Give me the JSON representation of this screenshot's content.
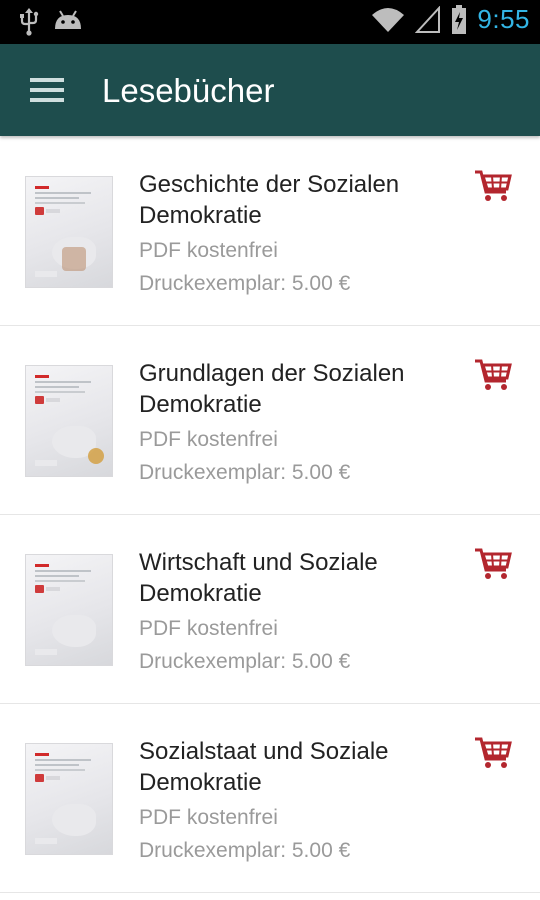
{
  "status_bar": {
    "time": "9:55",
    "icons": [
      "usb-icon",
      "android-icon",
      "wifi-icon",
      "signal-icon",
      "battery-charging-icon"
    ],
    "accent_color": "#33b5e5"
  },
  "action_bar": {
    "title": "Lesebücher",
    "menu_icon": "hamburger-menu-icon",
    "background_color": "#1e4d4d"
  },
  "books": [
    {
      "title": "Geschichte der Sozialen Demokratie",
      "pdf": "PDF kostenfrei",
      "print": "Druckexemplar: 5.00 €"
    },
    {
      "title": "Grundlagen der Sozialen Demokratie",
      "pdf": "PDF kostenfrei",
      "print": "Druckexemplar: 5.00 €"
    },
    {
      "title": "Wirtschaft und Soziale Demokratie",
      "pdf": "PDF kostenfrei",
      "print": "Druckexemplar: 5.00 €"
    },
    {
      "title": "Sozialstaat und Soziale Demokratie",
      "pdf": "PDF kostenfrei",
      "print": "Druckexemplar: 5.00 €"
    }
  ],
  "cart_icon": "shopping-cart-icon",
  "cart_color": "#b3262e"
}
